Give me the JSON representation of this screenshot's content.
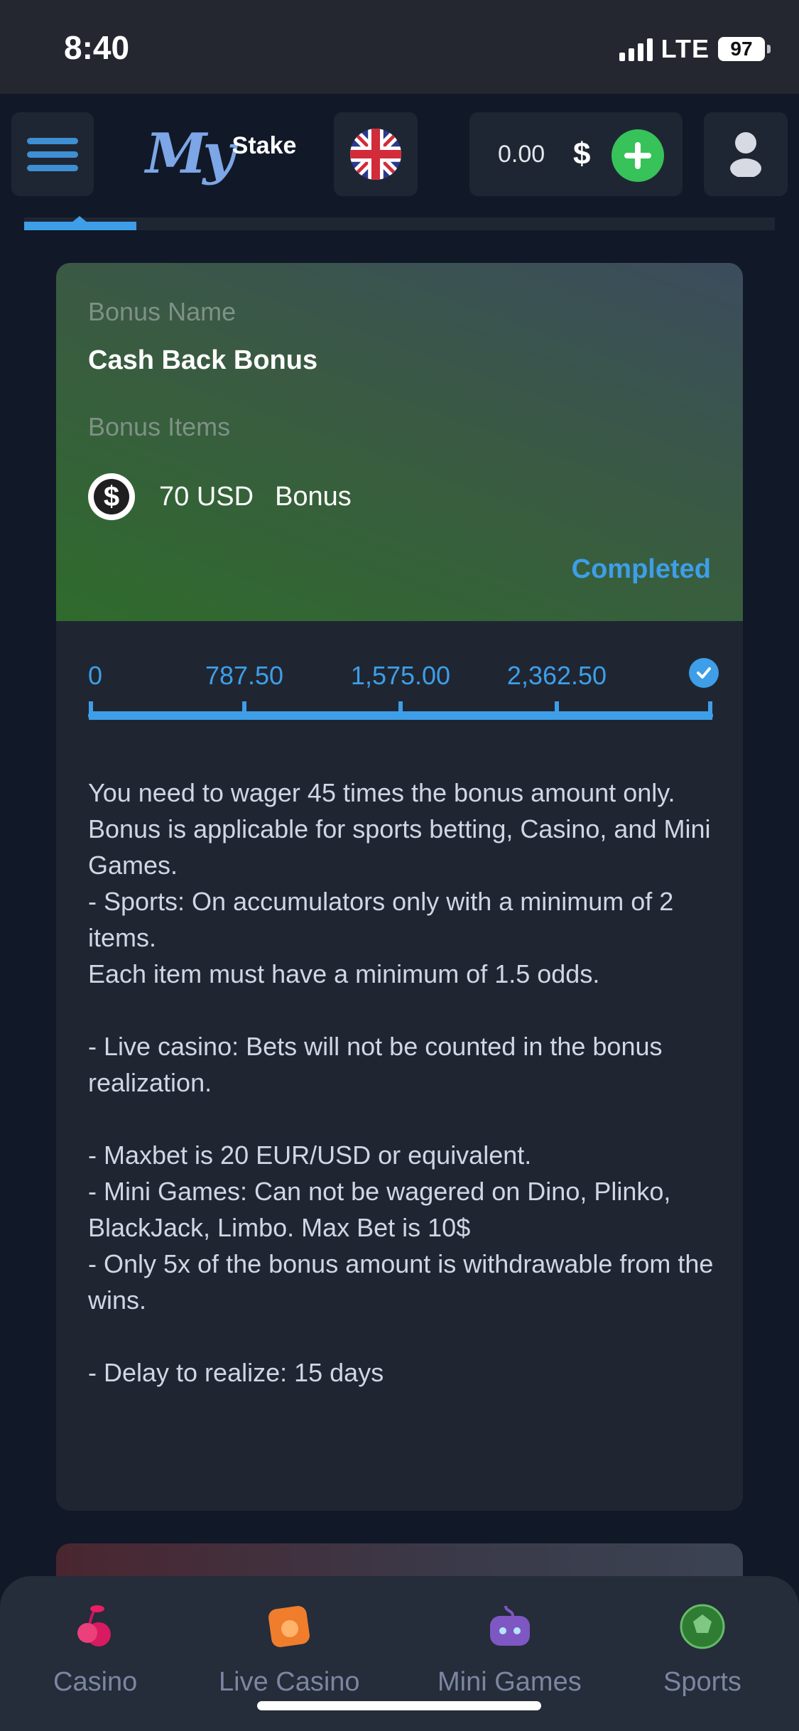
{
  "status_bar": {
    "time": "8:40",
    "network": "LTE",
    "battery": "97"
  },
  "header": {
    "logo_my": "My",
    "logo_stake": "Stake",
    "balance": "0.00",
    "currency": "$"
  },
  "bonus": {
    "name_label": "Bonus Name",
    "name": "Cash Back Bonus",
    "items_label": "Bonus Items",
    "item_amount": "70 USD",
    "item_type": "Bonus",
    "status": "Completed",
    "progress": {
      "ticks": [
        "0",
        "787.50",
        "1,575.00",
        "2,362.50"
      ],
      "fraction_complete": 1.0
    },
    "terms": "You need to wager 45 times the bonus amount only.\nBonus is applicable for sports betting, Casino, and Mini Games.\n- Sports: On accumulators only with a minimum of 2 items.\nEach item must have a minimum of 1.5 odds.\n\n- Live casino: Bets will not be counted in the bonus realization.\n\n- Maxbet is 20 EUR/USD or equivalent.\n- Mini Games: Can not be wagered on Dino, Plinko, BlackJack, Limbo. Max Bet is 10$\n- Only 5x of the bonus amount is withdrawable from the wins.\n\n- Delay to realize: 15 days"
  },
  "bottom_nav": {
    "items": [
      {
        "label": "Casino",
        "icon": "cherry-icon"
      },
      {
        "label": "Live Casino",
        "icon": "chip-icon"
      },
      {
        "label": "Mini Games",
        "icon": "gamepad-icon"
      },
      {
        "label": "Sports",
        "icon": "ball-icon"
      }
    ]
  },
  "colors": {
    "accent": "#3e9ee8",
    "deposit": "#37c25a",
    "background": "#111827",
    "card": "#1f2632"
  }
}
